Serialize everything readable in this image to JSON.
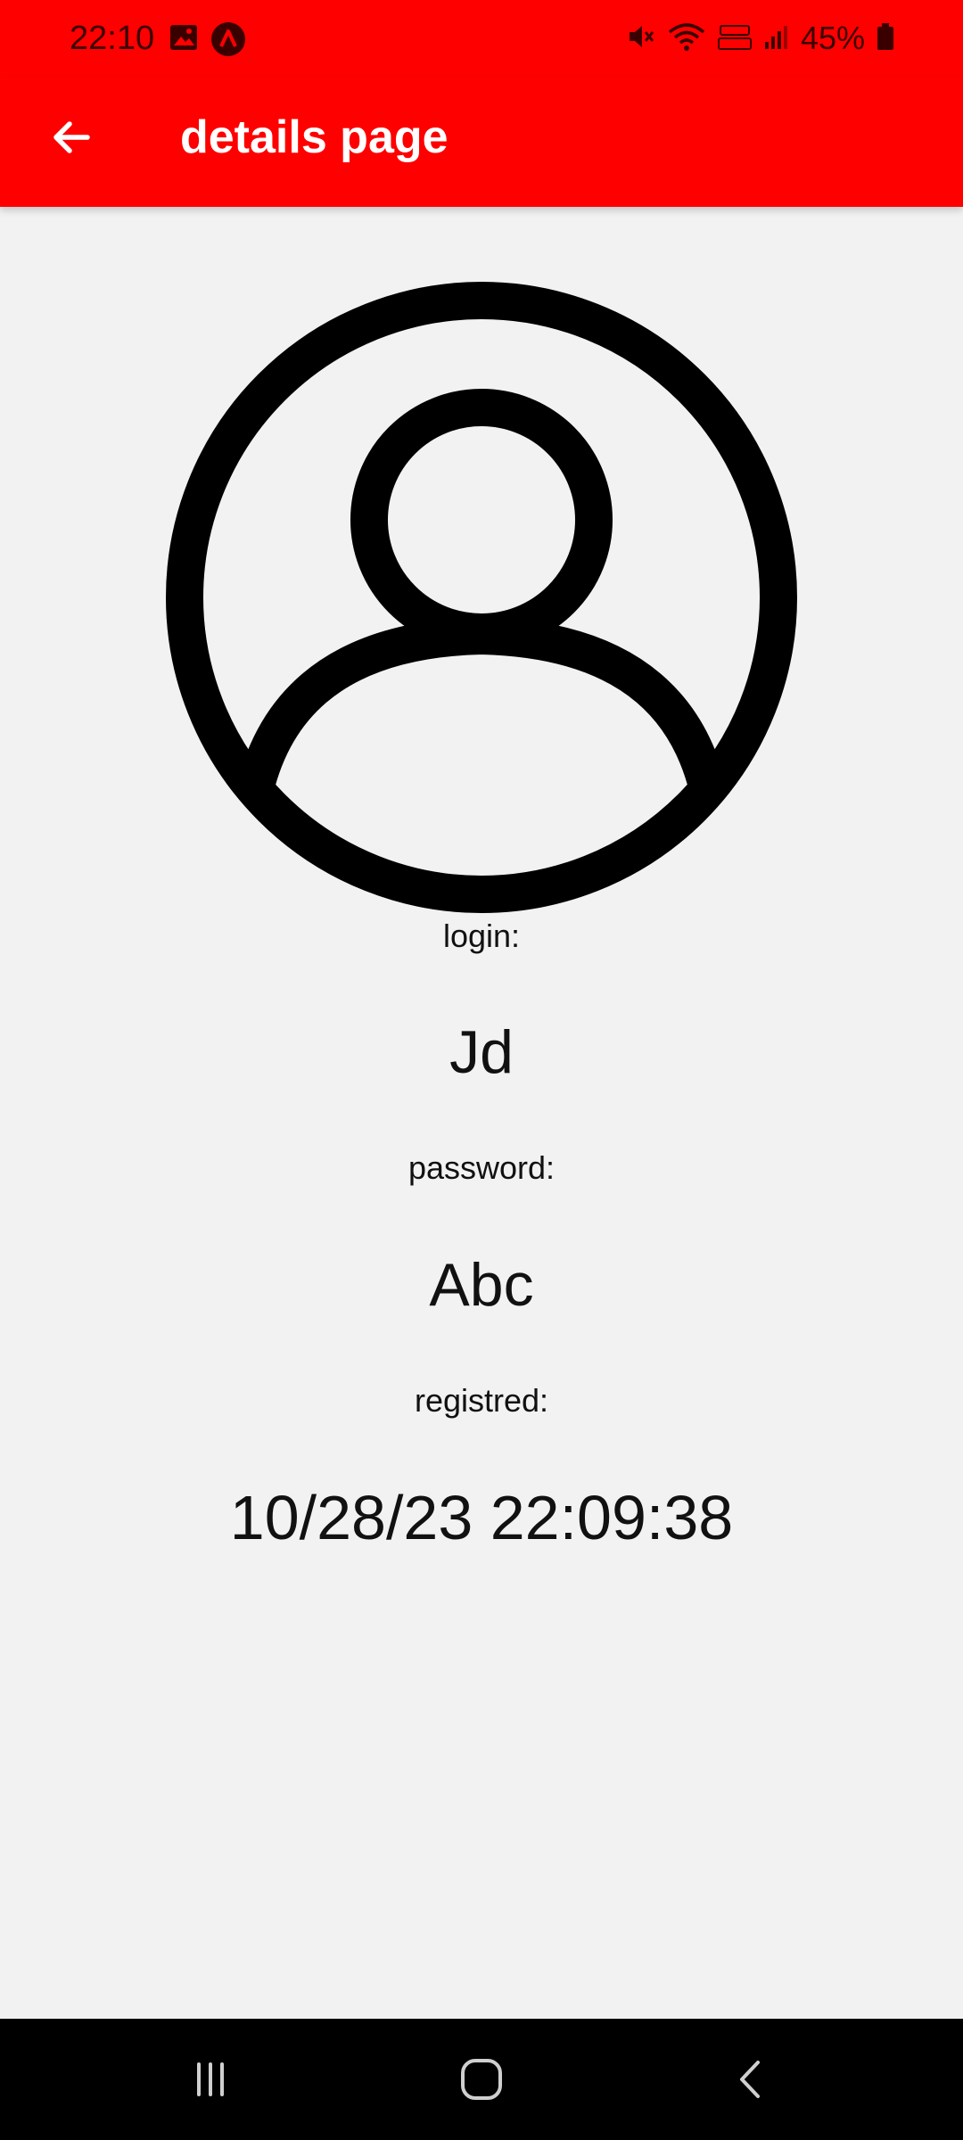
{
  "status_bar": {
    "time": "22:10",
    "battery": "45%"
  },
  "app_bar": {
    "title": "details page"
  },
  "details": {
    "login_label": "login:",
    "login_value": "Jd",
    "password_label": "password:",
    "password_value": "Abc",
    "registered_label": "registred:",
    "registered_value": "10/28/23 22:09:38"
  },
  "colors": {
    "app_bar": "#ff0000",
    "background": "#f2f2f2",
    "nav_bar": "#000000"
  }
}
